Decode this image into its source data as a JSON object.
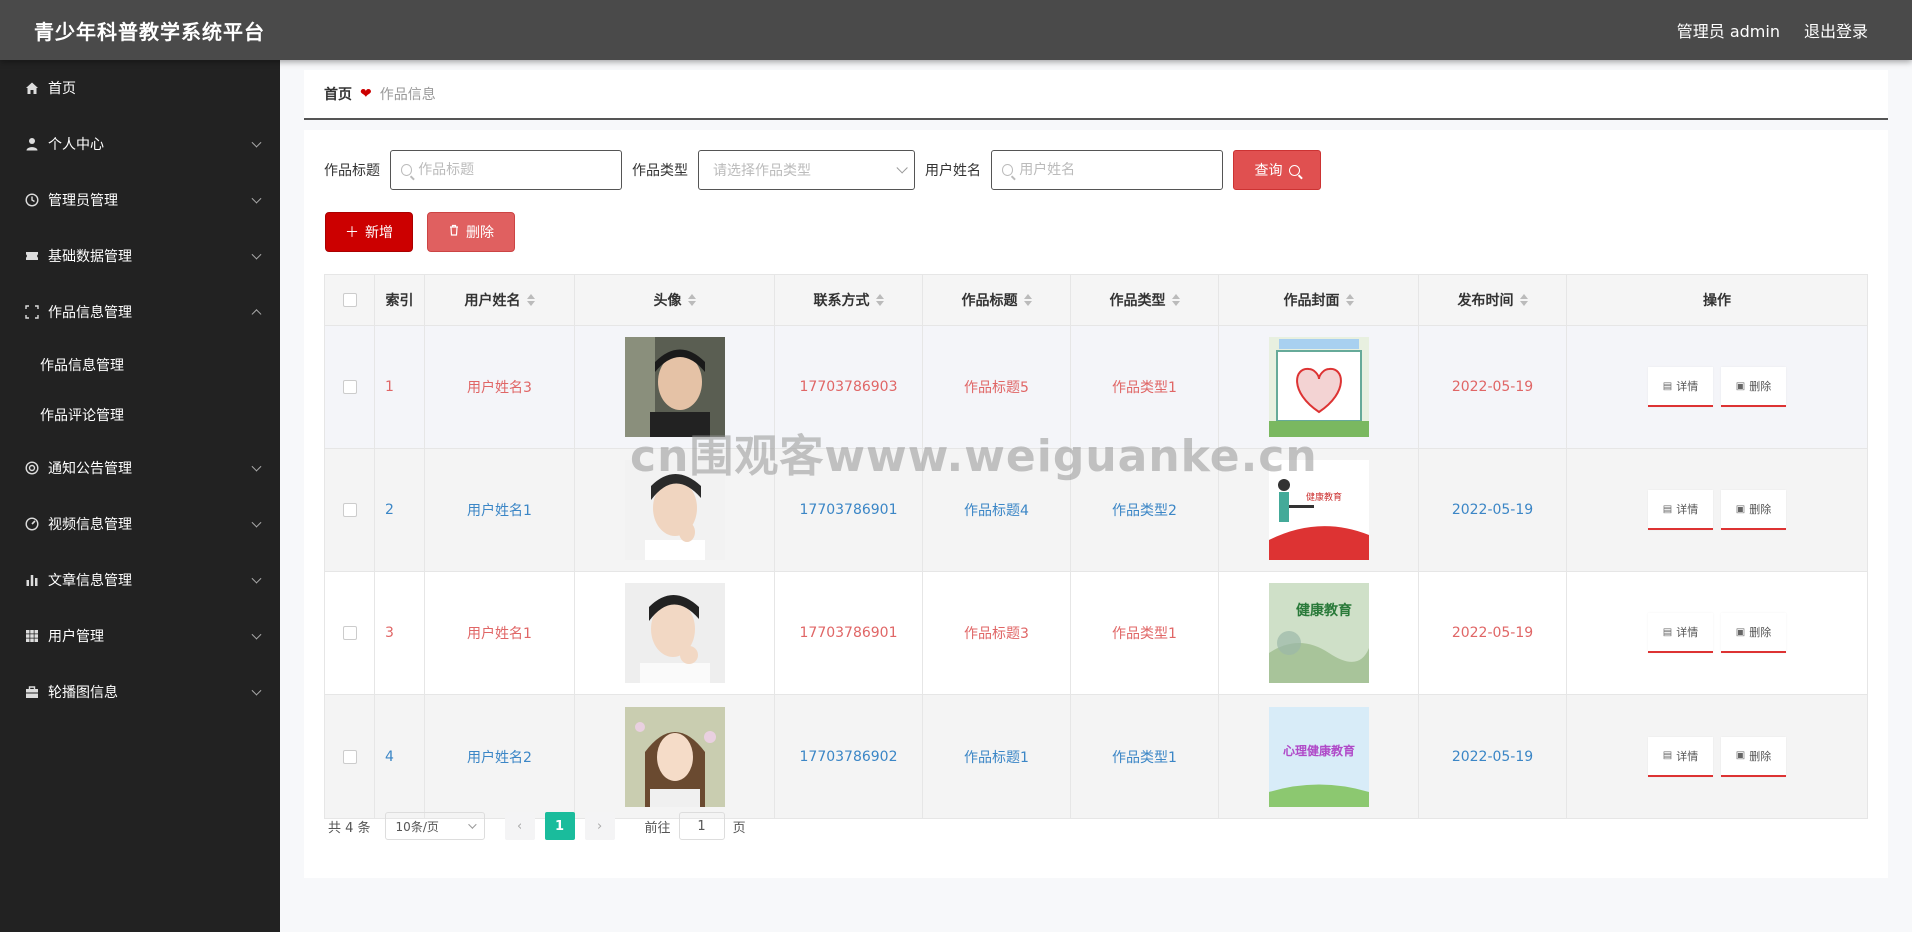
{
  "app": {
    "title": "青少年科普教学系统平台"
  },
  "header": {
    "admin_label": "管理员 admin",
    "logout_label": "退出登录"
  },
  "sidebar": {
    "items": [
      {
        "label": "首页",
        "icon": "home-icon"
      },
      {
        "label": "个人中心",
        "icon": "user-icon"
      },
      {
        "label": "管理员管理",
        "icon": "clock-icon"
      },
      {
        "label": "基础数据管理",
        "icon": "ticket-icon"
      },
      {
        "label": "作品信息管理",
        "icon": "scan-icon"
      },
      {
        "label": "通知公告管理",
        "icon": "target-icon"
      },
      {
        "label": "视频信息管理",
        "icon": "gauge-icon"
      },
      {
        "label": "文章信息管理",
        "icon": "bar-chart-icon"
      },
      {
        "label": "用户管理",
        "icon": "grid-icon"
      },
      {
        "label": "轮播图信息",
        "icon": "briefcase-icon"
      }
    ],
    "sub_items": [
      "作品信息管理",
      "作品评论管理"
    ]
  },
  "breadcrumb": {
    "home": "首页",
    "current": "作品信息"
  },
  "search": {
    "title_label": "作品标题",
    "title_placeholder": "作品标题",
    "type_label": "作品类型",
    "type_placeholder": "请选择作品类型",
    "user_label": "用户姓名",
    "user_placeholder": "用户姓名",
    "query_label": "查询"
  },
  "actions": {
    "add_label": "新增",
    "delete_label": "删除"
  },
  "table": {
    "headers": [
      "索引",
      "用户姓名",
      "头像",
      "联系方式",
      "作品标题",
      "作品类型",
      "作品封面",
      "发布时间",
      "操作"
    ],
    "rows": [
      {
        "index": "1",
        "name": "用户姓名3",
        "phone": "17703786903",
        "title": "作品标题5",
        "type": "作品类型1",
        "date": "2022-05-19"
      },
      {
        "index": "2",
        "name": "用户姓名1",
        "phone": "17703786901",
        "title": "作品标题4",
        "type": "作品类型2",
        "date": "2022-05-19"
      },
      {
        "index": "3",
        "name": "用户姓名1",
        "phone": "17703786901",
        "title": "作品标题3",
        "type": "作品类型1",
        "date": "2022-05-19"
      },
      {
        "index": "4",
        "name": "用户姓名2",
        "phone": "17703786902",
        "title": "作品标题1",
        "type": "作品类型1",
        "date": "2022-05-19"
      }
    ],
    "op_detail": "详情",
    "op_delete": "删除",
    "cover_texts": [
      "健康教育",
      "健康教育",
      "心理健康教育"
    ]
  },
  "pagination": {
    "total": "共 4 条",
    "page_size": "10条/页",
    "current_page": "1",
    "goto_prefix": "前往",
    "goto_value": "1",
    "goto_suffix": "页"
  },
  "watermark": "cn围观客www.weiguanke.cn",
  "colors": {
    "accent_red": "#cc0000",
    "row_red": "#e06666",
    "row_blue": "#3b86c6",
    "page_active": "#1abc9c"
  }
}
